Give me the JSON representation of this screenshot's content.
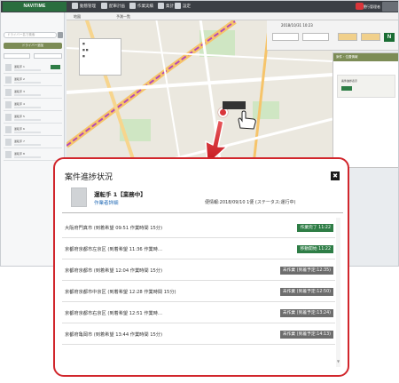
{
  "app": {
    "logo": "NAVITIME",
    "nav": [
      "動態管理",
      "配車計画",
      "作業実績",
      "集計",
      "設定"
    ],
    "user": "運行管理者",
    "map_tabs": [
      "地図",
      "予測一覧"
    ],
    "datetime": "2018/10/31 10:23",
    "search_placeholder": "ドライバー名で検索",
    "sidebar_button": "ドライバー追加",
    "sidebar_names": [
      "運転手 1",
      "運転手 2",
      "運転手 3",
      "運転手 4",
      "運転手 5",
      "運転手 6",
      "運転手 7",
      "運転手 8"
    ],
    "right_panel_title": "案件・位置情報",
    "right_panel_card": "案件進捗表示",
    "n_badge": "N"
  },
  "popup": {
    "title": "案件進捗状況",
    "close_glyph": "✖",
    "driver_name": "運転手 1【業務中】",
    "driver_link": "作業者詳細",
    "trip_info": "便情報:2018/09/10 1便 (ステータス:運行中)",
    "jobs": [
      {
        "text": "大阪府門真市 (到着希望 09:51 作業時間 15分)",
        "status": "作業完了 11:22"
      },
      {
        "text": "京都府京都市左京区 (到着希望 11:36 作業時…",
        "status": "移動開始 11:22"
      },
      {
        "text": "京都府京都市 (到着希望 12:04 作業時間 15分)",
        "status": "未作業 (到着予定:12:35)"
      },
      {
        "text": "京都府京都市中京区 (到着希望 12:28 作業時間 15分)",
        "status": "未作業 (到着予定:12:50)"
      },
      {
        "text": "京都府京都市右京区 (到着希望 12:51 作業時…",
        "status": "未作業 (到着予定:13:24)"
      },
      {
        "text": "京都府亀岡市 (到着希望 13:44 作業時間 15分)",
        "status": "未作業 (到着予定:14:13)"
      }
    ]
  },
  "colors": {
    "accent_red": "#d1262c",
    "status_done": "#2e7d46",
    "status_moving": "#2e7d46",
    "status_pending": "#6d6d6d",
    "link": "#2a6fb8"
  }
}
